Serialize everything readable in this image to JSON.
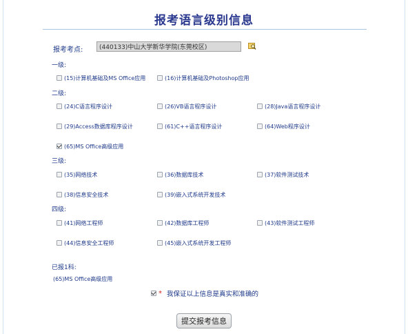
{
  "title": "报考语言级别信息",
  "site_label": "报考考点:",
  "site_value": "(440133)中山大学新华学院(东莞校区)",
  "levels": {
    "l1": "一级:",
    "l2": "二级:",
    "l3": "三级:",
    "l4": "四级:"
  },
  "options": {
    "o15": "(15)计算机基础及MS Office应用",
    "o16": "(16)计算机基础及Photoshop应用",
    "o24": "(24)C语言程序设计",
    "o26": "(26)VB语言程序设计",
    "o28": "(28)Java语言程序设计",
    "o29": "(29)Access数据库程序设计",
    "o61": "(61)C++语言程序设计",
    "o64": "(64)Web程序设计",
    "o65": "(65)MS Office高级应用",
    "o35": "(35)网络技术",
    "o36": "(36)数据库技术",
    "o37": "(37)软件测试技术",
    "o38": "(38)信息安全技术",
    "o39": "(39)嵌入式系统开发技术",
    "o41": "(41)网络工程师",
    "o42": "(42)数据库工程师",
    "o43": "(43)软件测试工程师",
    "o44": "(44)信息安全工程师",
    "o45": "(45)嵌入式系统开发工程师"
  },
  "checked": [
    "o65"
  ],
  "selected_label": "已报1科:",
  "selected_item": "(65)MS Office高级应用",
  "agree_star": "*",
  "agree_text": "我保证以上信息是真实和准确的",
  "agree_checked": true,
  "submit_label": "提交报考信息"
}
